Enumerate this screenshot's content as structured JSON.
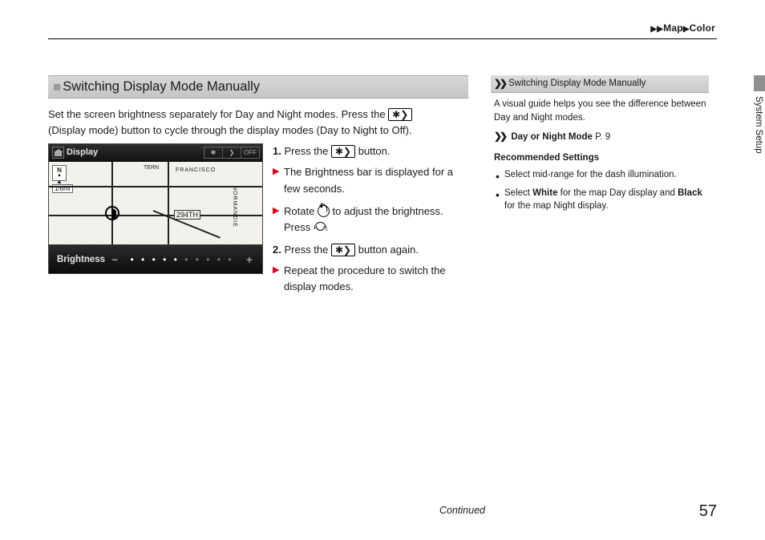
{
  "breadcrumb": {
    "map": "Map",
    "color": "Color"
  },
  "section": {
    "heading": "Switching Display Mode Manually",
    "intro_a": "Set the screen brightness separately for Day and Night modes. Press the ",
    "btn_symbol": "✱❯",
    "intro_b": "(Display mode) button to cycle through the display modes (Day to Night to Off)."
  },
  "screenshot": {
    "title": "Display",
    "right_segments": [
      "✱",
      "❯",
      "OFF"
    ],
    "compass_n": "N",
    "compass_arrow": "▲",
    "scale": "1/8mi",
    "road_labels": {
      "tern": "TERN",
      "francisco": "FRANCISCO",
      "normandie": "NORMANDIE",
      "r294": "294TH"
    },
    "brightness_label": "Brightness",
    "minus": "−",
    "plus": "+"
  },
  "steps": {
    "s1_a": "1. ",
    "s1_b": "Press the ",
    "s1_btn": "✱❯",
    "s1_c": " button.",
    "s1_sub": "The Brightness bar is displayed for a few seconds.",
    "s1_sub2_a": "Rotate ",
    "s1_sub2_b": " to adjust the brightness. Press ",
    "s1_sub2_c": ".",
    "s2_a": "2. ",
    "s2_b": "Press the ",
    "s2_btn": "✱❯",
    "s2_c": " button again.",
    "s2_sub": "Repeat the procedure to switch the display modes."
  },
  "sidebar": {
    "title": "Switching Display Mode Manually",
    "body": "A visual guide helps you see the difference between Day and Night modes.",
    "xref_label": "Day or Night Mode",
    "xref_page": "P. 9",
    "rec_heading": "Recommended Settings",
    "rec1": "Select mid-range for the dash illumination.",
    "rec2_a": "Select ",
    "rec2_white": "White",
    "rec2_b": " for the map Day display and ",
    "rec2_black": "Black",
    "rec2_c": " for the map Night display."
  },
  "side_tab": "System Setup",
  "continued": "Continued",
  "page_number": "57"
}
